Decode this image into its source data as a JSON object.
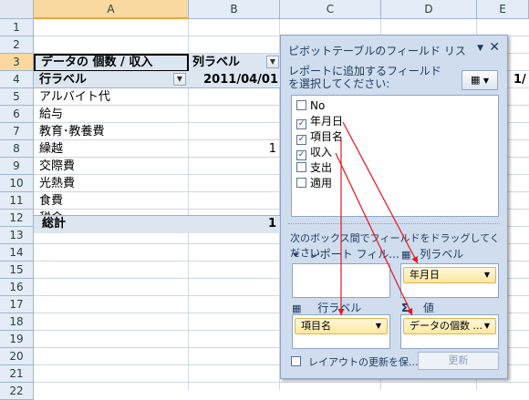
{
  "columns": [
    "A",
    "B",
    "C",
    "D",
    "E"
  ],
  "rows": [
    "1",
    "2",
    "3",
    "4",
    "5",
    "6",
    "7",
    "8",
    "9",
    "10",
    "11",
    "12",
    "13",
    "14",
    "15",
    "16",
    "17",
    "18",
    "19",
    "20",
    "21",
    "22"
  ],
  "pivot": {
    "data_field_label": "データの 個数 / 収入",
    "column_label": "列ラベル",
    "row_label": "行ラベル",
    "date_header": "2011/04/01",
    "date_header_partial": "1/",
    "row_items": [
      "アルバイト代",
      "給与",
      "教育･教養費",
      "繰越",
      "交際費",
      "光熱費",
      "食費",
      "税金"
    ],
    "繰越_value": "1",
    "total_label": "総計",
    "total_value": "1"
  },
  "field_list": {
    "title": "ピボットテーブルのフィールド リス",
    "instruction": "レポートに追加するフィールドを選択してください:",
    "fields": [
      {
        "name": "No",
        "checked": false
      },
      {
        "name": "年月日",
        "checked": true
      },
      {
        "name": "項目名",
        "checked": true
      },
      {
        "name": "収入",
        "checked": true
      },
      {
        "name": "支出",
        "checked": false
      },
      {
        "name": "適用",
        "checked": false
      }
    ],
    "drag_instruction": "次のボックス間でフィールドをドラッグしてください:",
    "report_filter_label": "レポート フィル...",
    "column_labels_label": "列ラベル",
    "row_labels_label": "行ラベル",
    "values_label": "値",
    "column_chip": "年月日",
    "row_chip": "項目名",
    "values_chip": "データの個数 ...",
    "defer_label": "レイアウトの更新を保...",
    "update_button": "更新"
  }
}
